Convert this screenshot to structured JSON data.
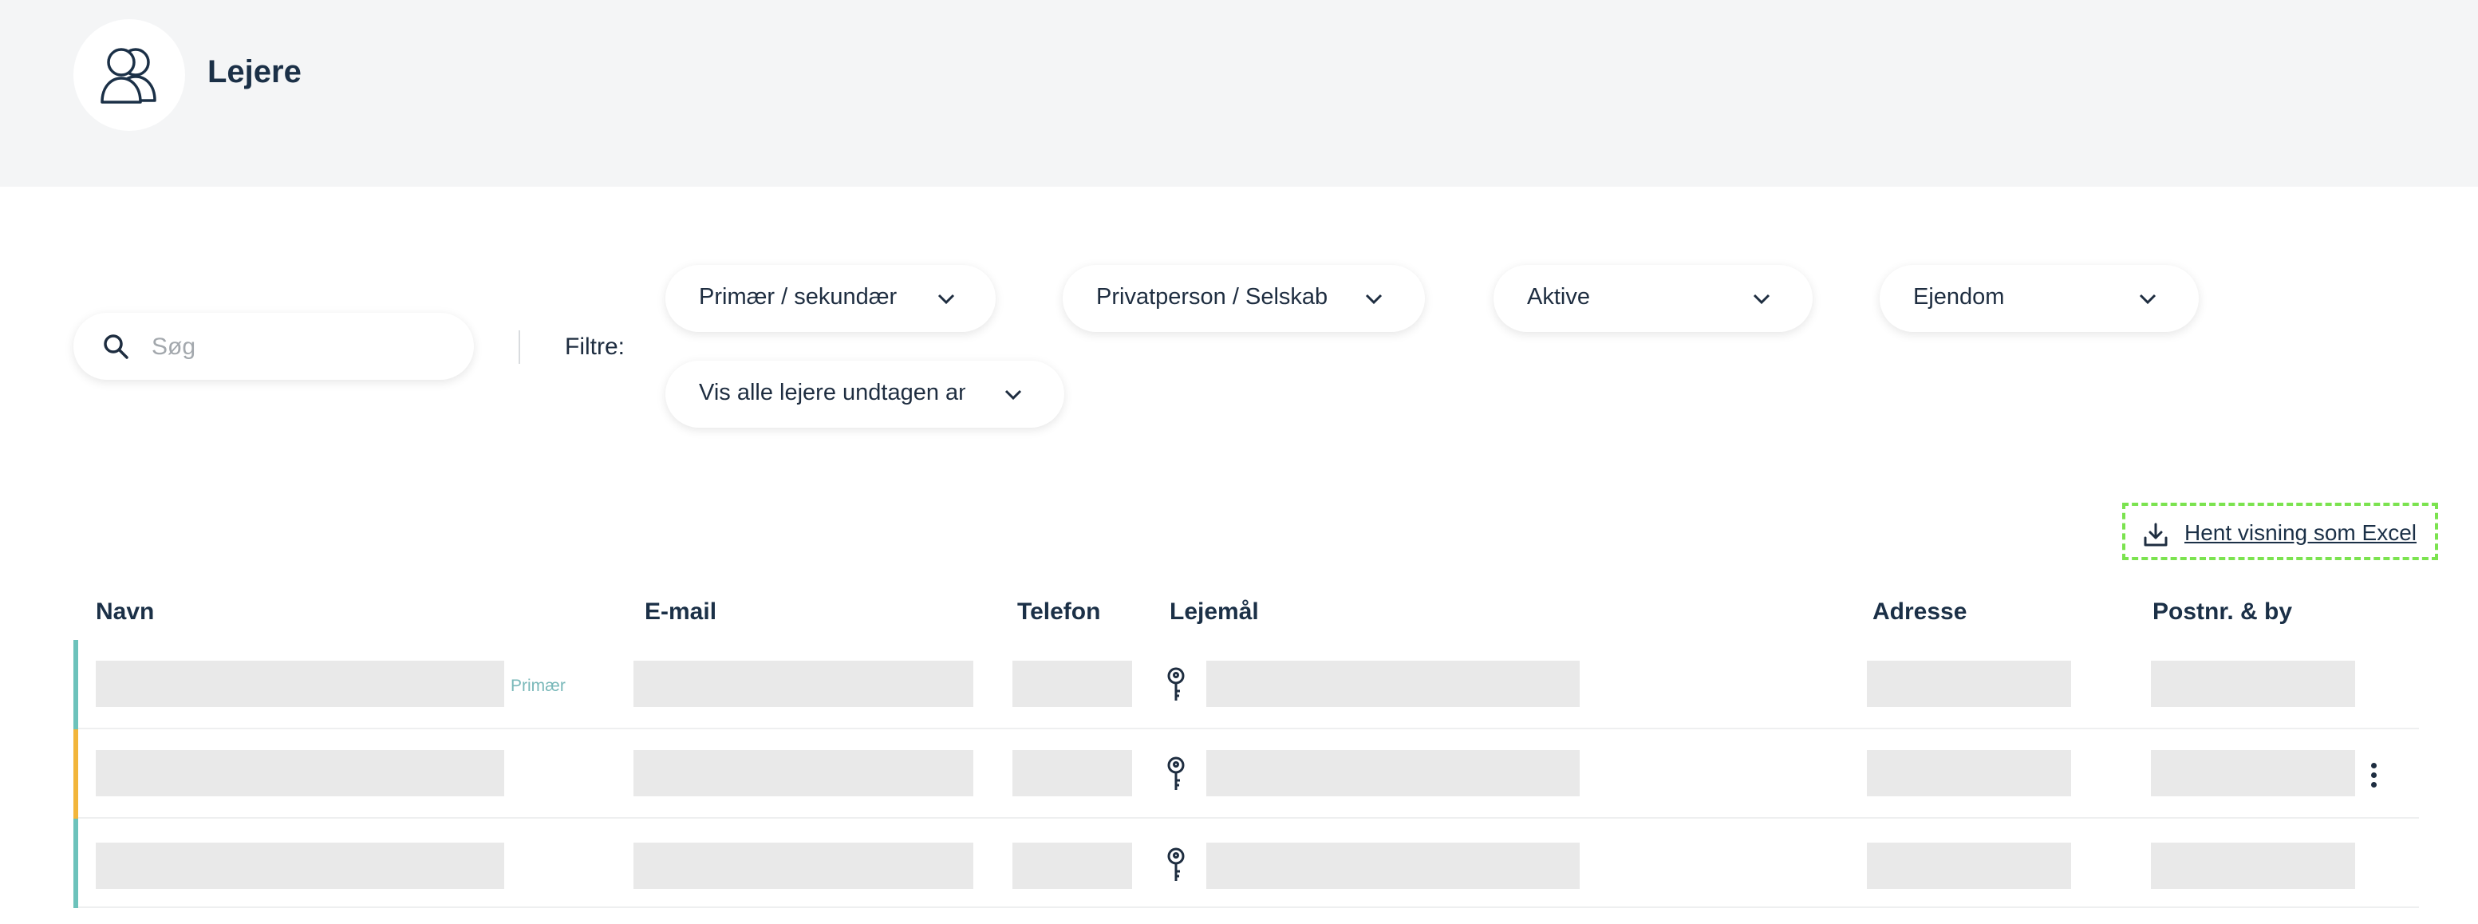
{
  "header": {
    "title": "Lejere",
    "avatar_icon": "users-icon"
  },
  "search": {
    "placeholder": "Søg",
    "value": ""
  },
  "filters": {
    "label": "Filtre:",
    "dropdowns": [
      {
        "label": "Primær / sekundær"
      },
      {
        "label": "Privatperson / Selskab"
      },
      {
        "label": "Aktive"
      },
      {
        "label": "Ejendom"
      },
      {
        "label": "Vis alle lejere undtagen an"
      }
    ]
  },
  "export": {
    "label": "Hent visning som Excel",
    "icon": "download-icon"
  },
  "table": {
    "columns": [
      "Navn",
      "E-mail",
      "Telefon",
      "Lejemål",
      "Adresse",
      "Postnr. & by"
    ],
    "rows": [
      {
        "status_color": "#6cc2bb",
        "tag": "Primær",
        "menu": false
      },
      {
        "status_color": "#f2b53a",
        "tag": "",
        "menu": true
      },
      {
        "status_color": "#6cc2bb",
        "tag": "",
        "menu": false
      }
    ]
  },
  "colors": {
    "primary_text": "#1b3047",
    "accent_teal": "#6cc2bb",
    "accent_yellow": "#f2b53a",
    "focus_outline": "#7be34f"
  }
}
